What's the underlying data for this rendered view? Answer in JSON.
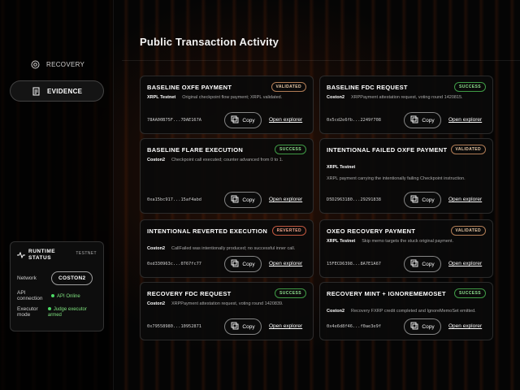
{
  "sidebar": {
    "items": [
      {
        "label": "RECOVERY",
        "icon": "recovery-icon"
      },
      {
        "label": "EVIDENCE",
        "icon": "evidence-icon"
      }
    ],
    "runtime": {
      "title_line1": "RUNTIME",
      "title_line2": "STATUS",
      "badge": "TESTNET",
      "network_label": "Network",
      "network_value": "COSTON2",
      "api_label": "API connection",
      "api_value": "API Online",
      "executor_label_1": "Executor",
      "executor_label_2": "mode",
      "executor_value": "Judge executor armed"
    }
  },
  "main": {
    "title": "Public Transaction Activity",
    "copy_label": "Copy",
    "explorer_label": "Open explorer",
    "cards": [
      {
        "title": "BASELINE OXFE PAYMENT",
        "status": "VALIDATED",
        "network": "XRPL Testnet",
        "desc": "Original checkpoint flow payment; XRPL validated.",
        "hash": "78AA00B75F...7DAE167A"
      },
      {
        "title": "BASELINE FDC REQUEST",
        "status": "SUCCESS",
        "network": "Coston2",
        "desc": "XRPPayment attestation request, voting round 1420815.",
        "hash": "0x5cd2e6fb...2249f708"
      },
      {
        "title": "BASELINE FLARE EXECUTION",
        "status": "SUCCESS",
        "network": "Coston2",
        "desc": "Checkpoint call executed; counter advanced from 0 to 1.",
        "hash": "0xa15bc917...15af4abd"
      },
      {
        "title": "INTENTIONAL FAILED OXFE PAYMENT",
        "status": "VALIDATED",
        "network": "XRPL Testnet",
        "desc": "XRPL payment carrying the intentionally failing Checkpoint instruction.",
        "hash": "D5D2963180...29291838"
      },
      {
        "title": "INTENTIONAL REVERTED EXECUTION",
        "status": "REVERTED",
        "network": "Coston2",
        "desc": "CallFailed was intentionally produced; no successful inner call.",
        "hash": "0xd330963c...0767fc77"
      },
      {
        "title": "OXEO RECOVERY PAYMENT",
        "status": "VALIDATED",
        "network": "XRPL Testnet",
        "desc": "Skip memo targets the stuck original payment.",
        "hash": "15FECD6398...8A7E1A67"
      },
      {
        "title": "RECOVERY FDC REQUEST",
        "status": "SUCCESS",
        "network": "Coston2",
        "desc": "XRPPayment attestation request, voting round 1420839.",
        "hash": "0x79558980...10952871"
      },
      {
        "title": "RECOVERY MINT + IGNOREMEMOSET",
        "status": "SUCCESS",
        "network": "Coston2",
        "desc": "Recovery FXRP credit completed and IgnoreMemoSet emitted.",
        "hash": "0x4e6d8f46...f0ae3e9f"
      }
    ]
  },
  "colors": {
    "validated": "#b07c55",
    "success": "#3f9a45",
    "reverted": "#c0573f",
    "online": "#4cd964"
  }
}
